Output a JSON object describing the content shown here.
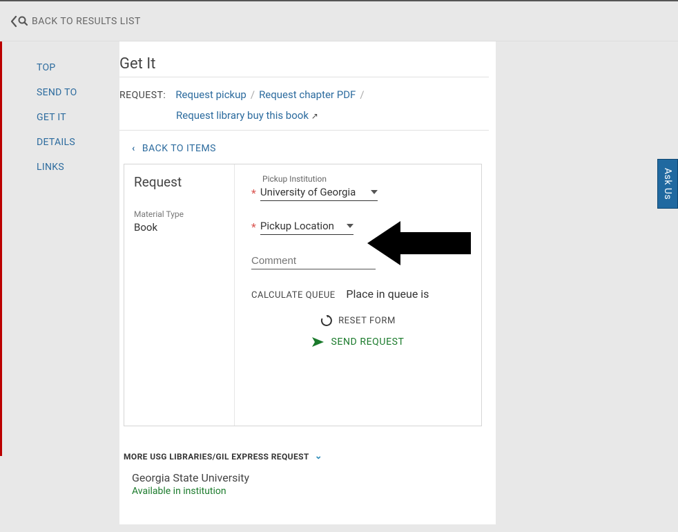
{
  "topbar": {
    "back_to_results": "BACK TO RESULTS LIST"
  },
  "sidebar": {
    "items": [
      {
        "label": "TOP"
      },
      {
        "label": "SEND TO"
      },
      {
        "label": "GET IT"
      },
      {
        "label": "DETAILS"
      },
      {
        "label": "LINKS"
      }
    ]
  },
  "main": {
    "title": "Get It",
    "request_label": "REQUEST:",
    "request_links": {
      "pickup": "Request pickup",
      "chapter_pdf": "Request chapter PDF",
      "buy_book": "Request library buy this book"
    },
    "back_to_items": "BACK TO ITEMS"
  },
  "request_form": {
    "title": "Request",
    "material_type_label": "Material Type",
    "material_type_value": "Book",
    "pickup_institution_label": "Pickup Institution",
    "pickup_institution_value": "University of Georgia",
    "pickup_location_label": "Pickup Location",
    "comment_placeholder": "Comment",
    "calc_queue": "CALCULATE QUEUE",
    "queue_text": "Place in queue is",
    "reset": "RESET FORM",
    "send": "SEND REQUEST"
  },
  "more_libs": {
    "label": "MORE USG LIBRARIES/GIL EXPRESS REQUEST",
    "institution": "Georgia State University",
    "availability": "Available in institution"
  },
  "ask_us": "Ask Us"
}
